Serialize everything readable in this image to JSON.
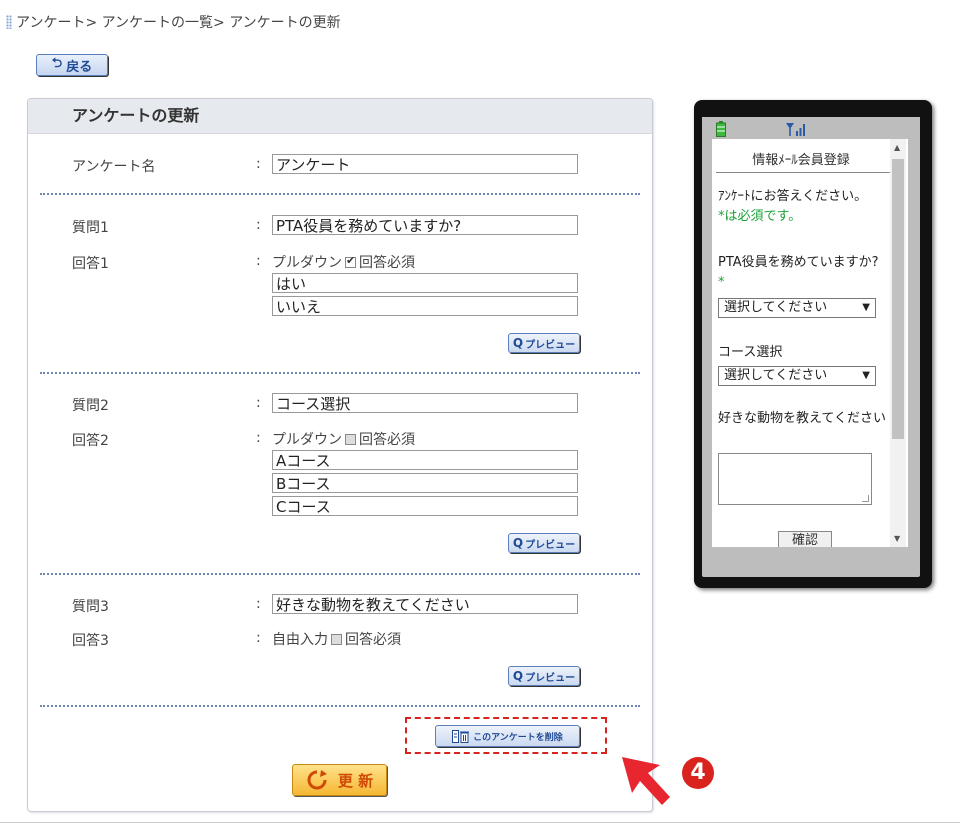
{
  "breadcrumb": "アンケート> アンケートの一覧> アンケートの更新",
  "back_button": "戻る",
  "panel": {
    "title": "アンケートの更新"
  },
  "form": {
    "survey_name_label": "アンケート名",
    "survey_name_value": "アンケート",
    "colon": ":",
    "questions": [
      {
        "q_label": "質問1",
        "q_value": "PTA役員を務めていますか?",
        "a_label": "回答1",
        "a_type": "プルダウン",
        "required_label": "回答必須",
        "required_checked": true,
        "options": [
          "はい",
          "いいえ"
        ]
      },
      {
        "q_label": "質問2",
        "q_value": "コース選択",
        "a_label": "回答2",
        "a_type": "プルダウン",
        "required_label": "回答必須",
        "required_checked": false,
        "options": [
          "Aコース",
          "Bコース",
          "Cコース"
        ]
      },
      {
        "q_label": "質問3",
        "q_value": "好きな動物を教えてください",
        "a_label": "回答3",
        "a_type": "自由入力",
        "required_label": "回答必須",
        "required_checked": false,
        "options": []
      }
    ],
    "preview_button": "プレビュー",
    "delete_button": "このアンケートを削除",
    "update_button": "更 新"
  },
  "phone": {
    "title": "情報ﾒｰﾙ会員登録",
    "intro": "ｱﾝｹｰﾄにお答えください。",
    "required_note": "*は必須です。",
    "q1": "PTA役員を務めていますか?",
    "required_mark": "*",
    "select_placeholder": "選択してください",
    "q2": "コース選択",
    "q3": "好きな動物を教えてください",
    "confirm_button": "確認"
  },
  "annotation": {
    "number": "4"
  },
  "colors": {
    "accent_blue": "#1f4a96",
    "update_orange": "#f5b733",
    "highlight_red": "#d9231f",
    "required_green": "#1da138"
  }
}
